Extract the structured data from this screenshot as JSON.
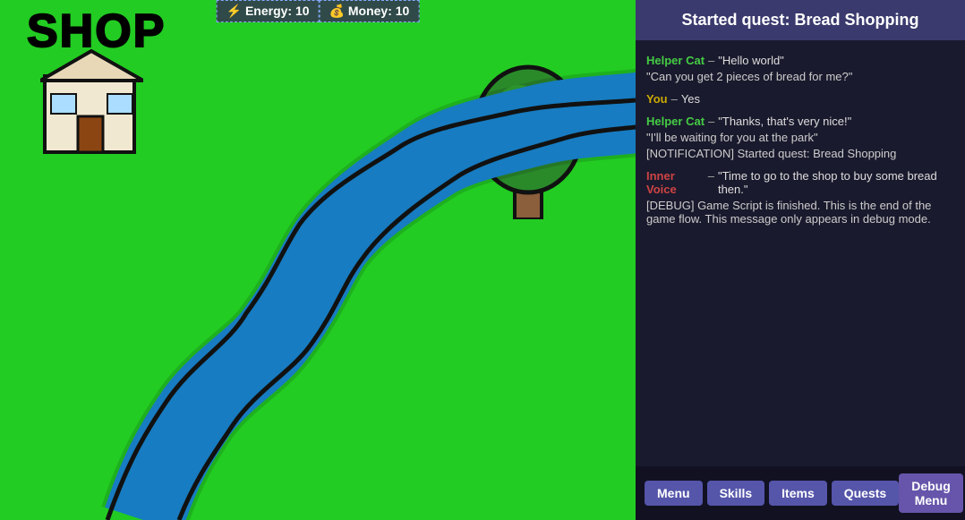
{
  "hud": {
    "energy_label": "⚡ Energy: 10",
    "money_label": "💰 Money: 10"
  },
  "game": {
    "shop_label": "SHOP"
  },
  "panel": {
    "quest_title": "Started quest: Bread Shopping",
    "chat": [
      {
        "speaker": "Helper Cat",
        "speaker_type": "helper",
        "dash": "–",
        "quote": "\"Hello world\"",
        "lines": [
          "\"Can you get 2 pieces of bread for me?\""
        ]
      },
      {
        "speaker": "You",
        "speaker_type": "you",
        "dash": "–",
        "quote": "Yes",
        "lines": []
      },
      {
        "speaker": "Helper Cat",
        "speaker_type": "helper",
        "dash": "–",
        "quote": "\"Thanks, that's very nice!\"",
        "lines": [
          "\"I'll be waiting for you at the park\"",
          "[NOTIFICATION] Started quest: Bread Shopping"
        ]
      },
      {
        "speaker": "Inner Voice",
        "speaker_type": "inner",
        "dash": "–",
        "quote": "\"Time to go to the shop to buy some bread then.\"",
        "lines": [
          "[DEBUG] Game Script is finished. This is the end of the game flow. This message only appears in debug mode."
        ]
      }
    ],
    "bottom_buttons": [
      "Menu",
      "Skills",
      "Items",
      "Quests"
    ],
    "debug_button": "Debug Menu"
  }
}
